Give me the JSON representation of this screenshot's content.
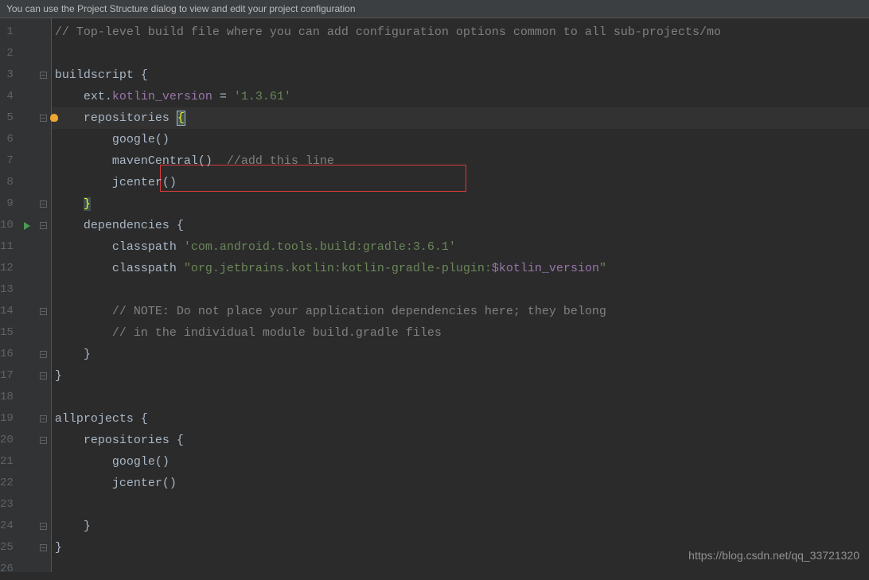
{
  "banner": {
    "message": "You can use the Project Structure dialog to view and edit your project configuration"
  },
  "code": {
    "lines": [
      {
        "num": "1",
        "tokens": [
          [
            "comment",
            "// Top-level build file where you can add configuration options common to all sub-projects/mo"
          ]
        ]
      },
      {
        "num": "2",
        "tokens": []
      },
      {
        "num": "3",
        "tokens": [
          [
            "default",
            "buildscript {"
          ]
        ]
      },
      {
        "num": "4",
        "tokens": [
          [
            "default",
            "    ext."
          ],
          [
            "identifier",
            "kotlin_version"
          ],
          [
            "default",
            " = "
          ],
          [
            "string",
            "'1.3.61'"
          ]
        ]
      },
      {
        "num": "5",
        "current": true,
        "tokens": [
          [
            "default",
            "    repositories "
          ],
          [
            "brace",
            "{"
          ]
        ]
      },
      {
        "num": "6",
        "tokens": [
          [
            "default",
            "        google()"
          ]
        ]
      },
      {
        "num": "7",
        "tokens": [
          [
            "default",
            "        mavenCentral()  "
          ],
          [
            "comment",
            "//add this line"
          ]
        ]
      },
      {
        "num": "8",
        "tokens": [
          [
            "default",
            "        jcenter()"
          ]
        ]
      },
      {
        "num": "9",
        "tokens": [
          [
            "default",
            "    "
          ],
          [
            "brace-match",
            "}"
          ]
        ]
      },
      {
        "num": "10",
        "run": true,
        "tokens": [
          [
            "default",
            "    dependencies {"
          ]
        ]
      },
      {
        "num": "11",
        "tokens": [
          [
            "default",
            "        classpath "
          ],
          [
            "string",
            "'com.android.tools.build:gradle:3.6.1'"
          ]
        ]
      },
      {
        "num": "12",
        "tokens": [
          [
            "default",
            "        classpath "
          ],
          [
            "string",
            "\"org.jetbrains.kotlin:kotlin-gradle-plugin:"
          ],
          [
            "identifier",
            "$kotlin_version"
          ],
          [
            "string",
            "\""
          ]
        ]
      },
      {
        "num": "13",
        "tokens": []
      },
      {
        "num": "14",
        "tokens": [
          [
            "default",
            "        "
          ],
          [
            "comment",
            "// NOTE: Do not place your application dependencies here; they belong"
          ]
        ]
      },
      {
        "num": "15",
        "tokens": [
          [
            "default",
            "        "
          ],
          [
            "comment",
            "// in the individual module build.gradle files"
          ]
        ]
      },
      {
        "num": "16",
        "tokens": [
          [
            "default",
            "    }"
          ]
        ]
      },
      {
        "num": "17",
        "tokens": [
          [
            "default",
            "}"
          ]
        ]
      },
      {
        "num": "18",
        "tokens": []
      },
      {
        "num": "19",
        "tokens": [
          [
            "default",
            "allprojects {"
          ]
        ]
      },
      {
        "num": "20",
        "tokens": [
          [
            "default",
            "    repositories {"
          ]
        ]
      },
      {
        "num": "21",
        "tokens": [
          [
            "default",
            "        google()"
          ]
        ]
      },
      {
        "num": "22",
        "tokens": [
          [
            "default",
            "        jcenter()"
          ]
        ]
      },
      {
        "num": "23",
        "tokens": []
      },
      {
        "num": "24",
        "tokens": [
          [
            "default",
            "    }"
          ]
        ]
      },
      {
        "num": "25",
        "tokens": [
          [
            "default",
            "}"
          ]
        ]
      },
      {
        "num": "26",
        "tokens": []
      }
    ]
  },
  "foldMarkers": [
    3,
    5,
    9,
    10,
    14,
    16,
    17,
    19,
    20,
    24,
    25
  ],
  "bulbLine": 5,
  "watermark": "https://blog.csdn.net/qq_33721320"
}
